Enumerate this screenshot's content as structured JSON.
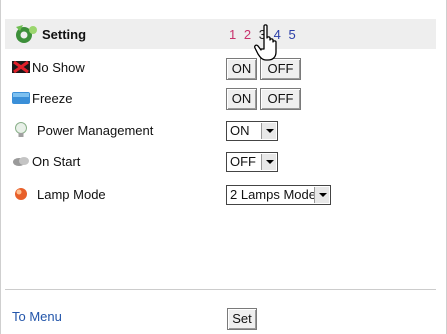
{
  "header": {
    "title": "Setting",
    "icon": "gear-icon",
    "pages": [
      "1",
      "2",
      "3",
      "4",
      "5"
    ]
  },
  "rows": {
    "no_show": {
      "label": "No Show",
      "icon": "no-show-icon",
      "on": "ON",
      "off": "OFF"
    },
    "freeze": {
      "label": "Freeze",
      "icon": "freeze-icon",
      "on": "ON",
      "off": "OFF"
    },
    "power": {
      "label": "Power Management",
      "icon": "lightbulb-icon",
      "value": "ON"
    },
    "on_start": {
      "label": "On Start",
      "icon": "on-start-icon",
      "value": "OFF"
    },
    "lamp": {
      "label": "Lamp Mode",
      "icon": "lamp-icon",
      "value": "2 Lamps Mode"
    }
  },
  "footer": {
    "menu_link": "To Menu",
    "set_label": "Set"
  },
  "colors": {
    "header_bg": "#eeeeee",
    "page_visited": "#c8326c",
    "page_link": "#2a3ea8",
    "menu_link": "#2255aa"
  }
}
